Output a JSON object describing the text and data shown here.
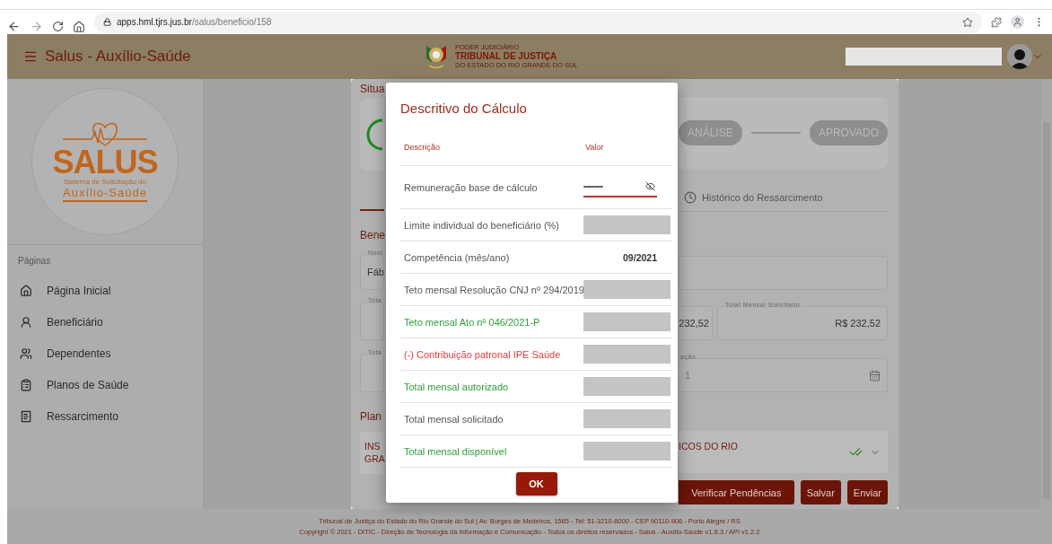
{
  "browser": {
    "url_host": "apps.hml.tjrs.jus.br",
    "url_path": "/salus/beneficio/158"
  },
  "header": {
    "title": "Salus - Auxílio-Saúde",
    "emblem_lines": [
      "PODER JUDICIÁRIO",
      "TRIBUNAL DE JUSTIÇA",
      "DO ESTADO DO RIO GRANDE DO SUL"
    ]
  },
  "sidebar": {
    "logo": {
      "name": "SALUS",
      "subtitle": "Sistema de Solicitação do",
      "tagline": "Auxílio-Saúde"
    },
    "section": "Páginas",
    "items": [
      {
        "label": "Página Inicial"
      },
      {
        "label": "Beneficiário"
      },
      {
        "label": "Dependentes"
      },
      {
        "label": "Planos de Saúde"
      },
      {
        "label": "Ressarcimento"
      }
    ]
  },
  "background_left": {
    "status_heading": "Situa",
    "section_heading": "Bene",
    "name_label": "Nom",
    "name_value": "Fáb",
    "total_labels": [
      "Tota",
      "Tota"
    ],
    "plans_heading": "Plan",
    "plan_lines": [
      "INS",
      "GRA"
    ]
  },
  "background_right": {
    "steps": [
      "ANÁLISE",
      "APROVADO"
    ],
    "history_tab": "Histórico do Ressarcimento",
    "partial_amount": "232,52",
    "requested_label": "Total Mensal Solicitado",
    "requested_value": "R$ 232,52",
    "date_label": "ação",
    "date_value": "1",
    "plan_text": "ICOS DO RIO",
    "buttons": [
      "Verificar Pendências",
      "Salvar",
      "Enviar"
    ]
  },
  "modal": {
    "title": "Descritivo do Cálculo",
    "columns": [
      "Descrição",
      "Valor"
    ],
    "rows": [
      {
        "kind": "password",
        "label": "Remuneração base de cálculo",
        "color": "#555555",
        "value": "•••••••••••"
      },
      {
        "kind": "redacted",
        "label": "Limite individual do beneficiário (%)",
        "color": "#555555"
      },
      {
        "kind": "text",
        "label": "Competência (mês/ano)",
        "color": "#555555",
        "value": "09/2021"
      },
      {
        "kind": "redacted",
        "label": "Teto mensal Resolução CNJ nº 294/2019",
        "color": "#555555"
      },
      {
        "kind": "redacted",
        "label": "Teto mensal Ato nº 046/2021-P",
        "color": "#2e9e3a"
      },
      {
        "kind": "redacted",
        "label": "(-) Contribuição patronal IPE Saúde",
        "color": "#ee3a3a"
      },
      {
        "kind": "redacted",
        "label": "Total mensal autorizado",
        "color": "#2e9e3a"
      },
      {
        "kind": "redacted",
        "label": "Total mensal solicitado",
        "color": "#555555"
      },
      {
        "kind": "redacted",
        "label": "Total mensal disponível",
        "color": "#2e9e3a"
      }
    ],
    "ok": "OK"
  },
  "footer": {
    "lines": [
      "Tribunal de Justiça do Estado do Rio Grande do Sul | Av. Borges de Medeiros, 1565 - Tel: 51-3210-6000 - CEP 90110-906 - Porto Alegre / RS",
      "Copyright © 2021 - DITIC - Direção de Tecnologia da Informação e Comunicação - Todos os direitos reservados - Salus - Auxílio-Saúde v1.6.3 / API v1.2.2"
    ]
  }
}
